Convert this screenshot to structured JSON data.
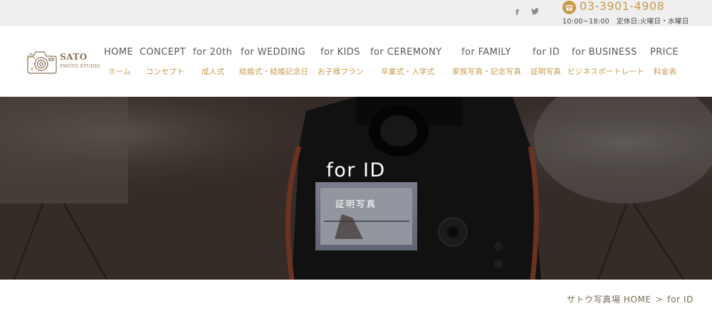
{
  "topbar": {
    "social": [
      {
        "name": "facebook-icon",
        "glyph": "f"
      },
      {
        "name": "twitter-icon",
        "glyph": "🐦"
      }
    ],
    "phone": "03-3901-4908",
    "hours": "10:00~18:00",
    "closed_days": "定休日:火曜日・水曜日"
  },
  "logo": {
    "name": "SATO",
    "subtitle": "PHOTO STUDIO"
  },
  "nav": {
    "en": [
      "HOME",
      "CONCEPT",
      "for 20th",
      "for WEDDING",
      "for KIDS",
      "for CEREMONY",
      "for FAMILY",
      "for ID",
      "for BUSINESS",
      "PRICE"
    ],
    "ja": [
      "ホーム",
      "コンセプト",
      "成人式",
      "結婚式・結婚記念日",
      "お子様プラン",
      "卒業式・入学式",
      "家族写真・記念写真",
      "証明写真",
      "ビジネスポートレート",
      "料金表"
    ]
  },
  "hero": {
    "title": "for ID",
    "subtitle": "証明写真"
  },
  "breadcrumb": {
    "home": "サトウ写真場 HOME",
    "separator": ">",
    "current": "for ID"
  },
  "colors": {
    "accent": "#c89a4c",
    "topbar_bg": "#efefef",
    "nav_text": "#5a5a5a"
  }
}
